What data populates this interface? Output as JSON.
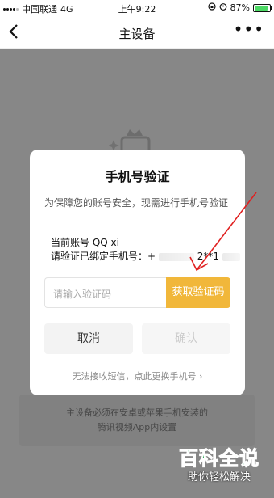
{
  "status_bar": {
    "carrier": "中国联通",
    "network": "4G",
    "time": "上午9:22",
    "battery": "87%",
    "battery_level": 0.87
  },
  "nav": {
    "title": "主设备",
    "back_icon": "chevron-left-icon",
    "more_icon": "more-dots-icon",
    "more_glyph": "•••"
  },
  "background": {
    "device_icon": "device-crown-icon",
    "notice_line1": "主设备必须在安卓或苹果手机安装的",
    "notice_line2": "腾讯视频App内设置"
  },
  "dialog": {
    "title": "手机号验证",
    "description": "为保障您的账号安全，现需进行手机号验证",
    "current_account_label": "当前账号 QQ xi",
    "bound_phone_label": "请验证已绑定手机号：+",
    "masked_phone": "2**1",
    "code_placeholder": "请输入验证码",
    "get_code_label": "获取验证码",
    "cancel_label": "取消",
    "confirm_label": "确认",
    "change_phone_link": "无法接收短信，点此更换手机号 ›"
  },
  "annotation": {
    "arrow_color": "#e02020"
  },
  "watermark": {
    "title": "百科全说",
    "subtitle": "助你轻松解决"
  },
  "colors": {
    "accent": "#f1b73a",
    "overlay": "rgba(0,0,0,0.47)"
  }
}
